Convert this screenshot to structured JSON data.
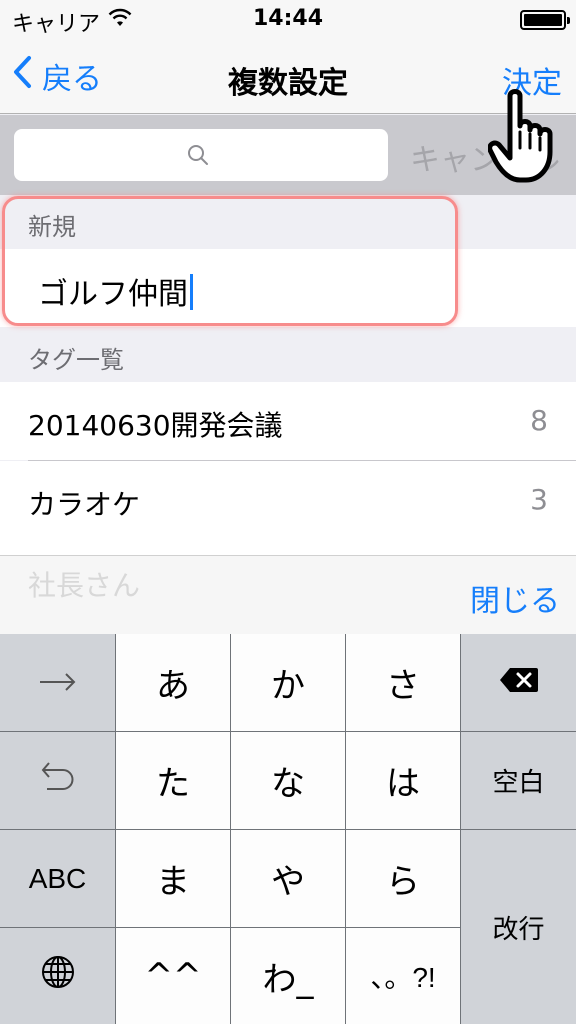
{
  "status_bar": {
    "carrier": "キャリア",
    "time": "14:44"
  },
  "nav": {
    "back_label": "戻る",
    "title": "複数設定",
    "done_label": "決定"
  },
  "search": {
    "placeholder": "",
    "cancel_label": "キャンセル"
  },
  "new_section": {
    "header": "新規",
    "value": "ゴルフ仲間"
  },
  "tags_section": {
    "header": "タグ一覧",
    "items": [
      {
        "name": "20140630開発会議",
        "count": "8"
      },
      {
        "name": "カラオケ",
        "count": "3"
      },
      {
        "name": "社長さん",
        "count": ""
      }
    ]
  },
  "accessory": {
    "close_label": "閉じる"
  },
  "keyboard": {
    "rows": [
      {
        "left": "→",
        "keys": [
          "あ",
          "か",
          "さ"
        ],
        "right": "⌫"
      },
      {
        "left": "↺",
        "keys": [
          "た",
          "な",
          "は"
        ],
        "right": "空白"
      },
      {
        "left": "ABC",
        "keys": [
          "ま",
          "や",
          "ら"
        ],
        "right": "改行"
      },
      {
        "left": "🌐",
        "keys": [
          "^^",
          "わ_",
          "、。?!"
        ],
        "right": ""
      }
    ]
  },
  "colors": {
    "accent": "#157efb",
    "highlight": "#f78c8c"
  }
}
